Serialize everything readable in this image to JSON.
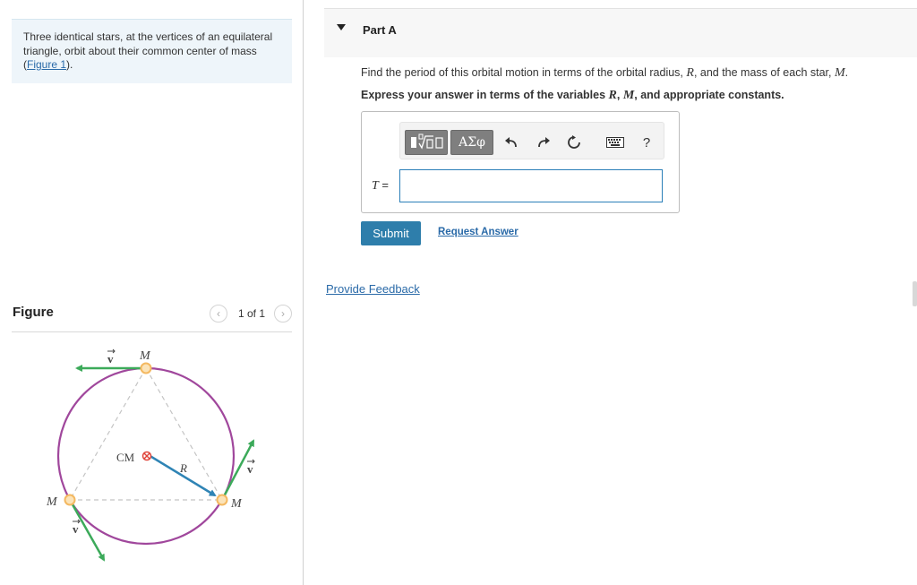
{
  "problem": {
    "intro_text": "Three identical stars, at the vertices of an equilateral triangle, orbit about their common center of mass (",
    "figure_link": "Figure 1",
    "intro_end": ")."
  },
  "figure_panel": {
    "title": "Figure",
    "pager": "1 of 1",
    "labels": {
      "mass_top": "M",
      "mass_left": "M",
      "mass_right": "M",
      "velocity": "v",
      "cm": "CM",
      "radius": "R"
    },
    "colors": {
      "orbit": "#a0479c",
      "velocity_arrow": "#3caa5a",
      "radius_arrow": "#2f84b5",
      "star": "#f4b860",
      "cm_mark": "#e0443a"
    }
  },
  "part": {
    "title": "Part A",
    "question_prefix": "Find the period of this orbital motion in terms of the orbital radius, ",
    "var_r": "R",
    "question_mid": ", and the mass of each star, ",
    "var_m": "M",
    "question_end": ".",
    "instruction_prefix": "Express your answer in terms of the variables ",
    "instr_r": "R",
    "instr_sep": ", ",
    "instr_m": "M",
    "instruction_end": ", and appropriate constants.",
    "toolbar": {
      "greek_label": "ΑΣφ",
      "help_label": "?"
    },
    "answer_label_var": "T",
    "answer_label_eq": " =",
    "answer_value": ""
  },
  "actions": {
    "submit": "Submit",
    "request_answer": "Request Answer",
    "provide_feedback": "Provide Feedback"
  }
}
